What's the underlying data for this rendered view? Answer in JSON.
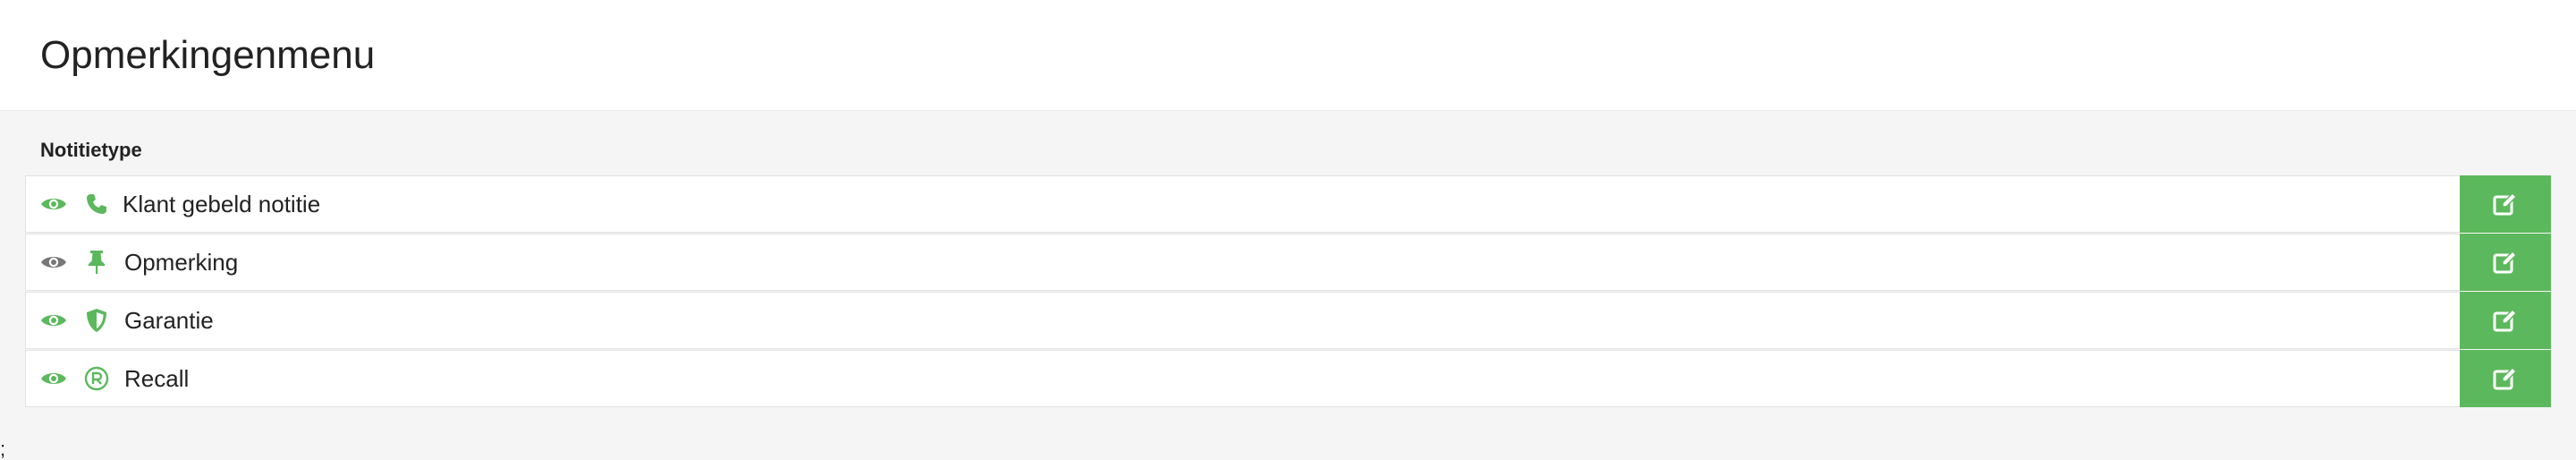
{
  "header": {
    "title": "Opmerkingenmenu"
  },
  "table": {
    "column_header": "Notitietype",
    "rows": [
      {
        "label": "Klant gebeld notitie",
        "visible": true,
        "icon": "phone-icon"
      },
      {
        "label": "Opmerking",
        "visible": false,
        "icon": "thumbtack-icon"
      },
      {
        "label": "Garantie",
        "visible": true,
        "icon": "shield-icon"
      },
      {
        "label": "Recall",
        "visible": true,
        "icon": "registered-icon"
      }
    ]
  },
  "footer": {
    "stray_text": ";"
  },
  "colors": {
    "accent_green": "#5cb85c",
    "eye_hidden_gray": "#777777",
    "background": "#f5f5f5"
  }
}
